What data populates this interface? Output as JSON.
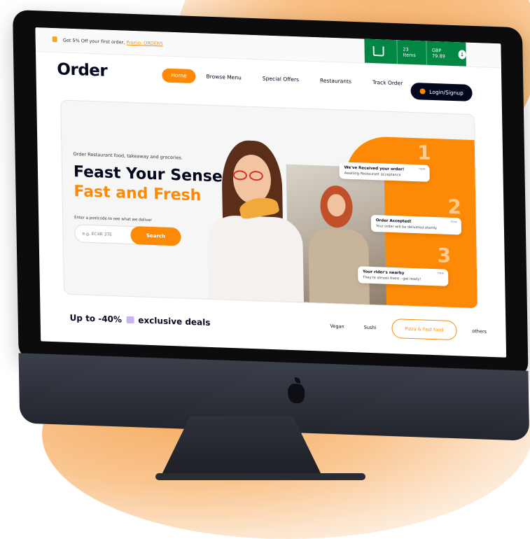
{
  "colors": {
    "brand_orange": "#fc8a06",
    "navy": "#03081f",
    "cart_green": "#028643"
  },
  "topbar": {
    "promo_text": "Get 5% Off your first order,",
    "promo_code": "Promo: ORDER5",
    "cart_items": "23 Items",
    "cart_total": "GBP 79.89"
  },
  "nav": {
    "logo": "Order",
    "items": [
      "Home",
      "Browse Menu",
      "Special Offers",
      "Restaurants",
      "Track Order"
    ],
    "login_label": "Login/Signup"
  },
  "hero": {
    "subtitle": "Order Restaurant food, takeaway and groceries.",
    "headline_1": "Feast Your Senses,",
    "headline_2": "Fast and Fresh",
    "postcode_hint": "Enter a postcode to see what we deliver",
    "search_placeholder": "e.g. EC4R 3TE",
    "search_button": "Search",
    "step_numbers": [
      "1",
      "2",
      "3"
    ],
    "notifications": [
      {
        "title": "We've Received your order!",
        "detail": "Awaiting Restaurant acceptance",
        "time": "now"
      },
      {
        "title": "Order Accepted!",
        "detail": "Your order will be delivered shortly",
        "time": "now"
      },
      {
        "title": "Your rider's nearby",
        "detail": "They're almost there - get ready!",
        "time": "now"
      }
    ]
  },
  "deals": {
    "heading_prefix": "Up to -40%",
    "heading_suffix": "exclusive deals",
    "categories": [
      "Vegan",
      "Sushi",
      "Pizza & Fast food",
      "others"
    ]
  }
}
